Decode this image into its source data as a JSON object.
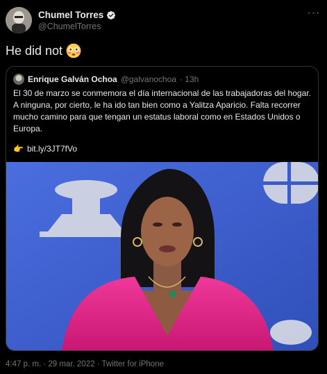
{
  "author": {
    "name": "Chumel Torres",
    "handle": "@ChumelTorres",
    "verified": true
  },
  "tweet": {
    "text": "He did not",
    "emoji": "flushed-face-emoji"
  },
  "quoted": {
    "name": "Enrique Galván Ochoa",
    "handle": "@galvanochoa",
    "time": "· 13h",
    "text": "El 30 de marzo se conmemora el día internacional de las trabajadoras del hogar. A ninguna, por cierto, le ha ido tan bien como a Yalitza Aparicio. Falta recorrer mucho camino para que tengan un estatus laboral como en Estados Unidos o Europa.",
    "link_icon": "pointing-hand-icon",
    "link": "bit.ly/3JT7fVo"
  },
  "footer": {
    "meta": "4:47 p. m. · 29 mar. 2022 · Twitter for iPhone"
  },
  "colors": {
    "background": "#000000",
    "text": "#e7e9ea",
    "muted": "#71767b",
    "border": "#2f3336",
    "verified": "#1d9bf0",
    "photo_backdrop": "#3f5fd0",
    "dress": "#e0227e"
  }
}
